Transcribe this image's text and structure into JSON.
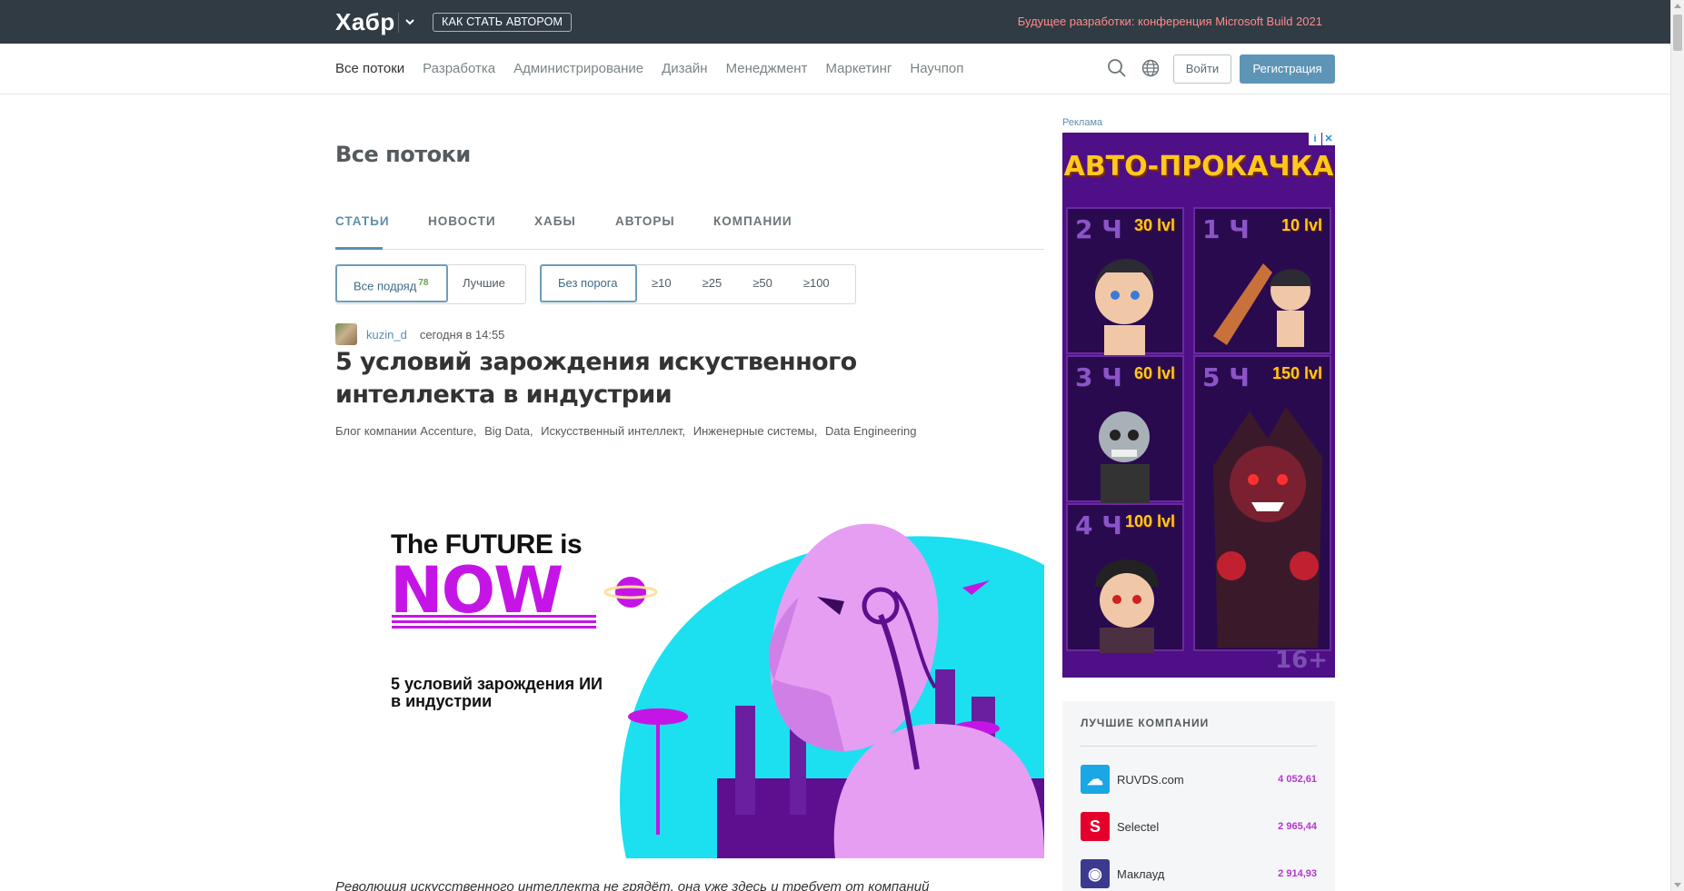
{
  "topbar": {
    "logo": "Хабр",
    "become_author": "КАК СТАТЬ АВТОРОМ",
    "promo": "Будущее разработки: конференция Microsoft Build 2021"
  },
  "nav": {
    "items": [
      "Все потоки",
      "Разработка",
      "Администрирование",
      "Дизайн",
      "Менеджмент",
      "Маркетинг",
      "Научпоп"
    ],
    "login": "Войти",
    "register": "Регистрация"
  },
  "page": {
    "title": "Все потоки",
    "tabs": [
      "СТАТЬИ",
      "НОВОСТИ",
      "ХАБЫ",
      "АВТОРЫ",
      "КОМПАНИИ"
    ]
  },
  "filters": {
    "sort": [
      "Все подряд",
      "Лучшие"
    ],
    "new_count": "78",
    "thresholds": [
      "Без порога",
      "≥10",
      "≥25",
      "≥50",
      "≥100"
    ]
  },
  "post": {
    "author": "kuzin_d",
    "time": "сегодня в 14:55",
    "title": "5 условий зарождения искуственного интеллекта в индустрии",
    "hubs": [
      "Блог компании Accenture,",
      "Big Data,",
      "Искусственный интеллект,",
      "Инженерные системы,",
      "Data Engineering"
    ],
    "image": {
      "line1": "The FUTURE is",
      "line2": "NOW",
      "line3": "5 условий зарождения ИИ",
      "line4": "в индустрии"
    },
    "excerpt": "Революция искусственного интеллекта не грядёт, она уже здесь и требует от компаний"
  },
  "sidebar": {
    "ad_label": "Реклама",
    "ad": {
      "title": "АВТО-ПРОКАЧКА",
      "cells": [
        {
          "time": "2 Ч",
          "level": "30 lvl"
        },
        {
          "time": "1 Ч",
          "level": "10 lvl"
        },
        {
          "time": "3 Ч",
          "level": "60 lvl"
        },
        {
          "time": "5 Ч",
          "level": "150 lvl"
        },
        {
          "time": "4 Ч",
          "level": "100 lvl"
        }
      ],
      "age": "16+"
    },
    "companies_title": "ЛУЧШИЕ КОМПАНИИ",
    "companies": [
      {
        "name": "RUVDS.com",
        "rating": "4 052,61",
        "color": "#1ba6e5",
        "glyph": "☁"
      },
      {
        "name": "Selectel",
        "rating": "2 965,44",
        "color": "#e4002b",
        "glyph": "S"
      },
      {
        "name": "Маклауд",
        "rating": "2 914,93",
        "color": "#3b3a8f",
        "glyph": "◉"
      }
    ]
  }
}
